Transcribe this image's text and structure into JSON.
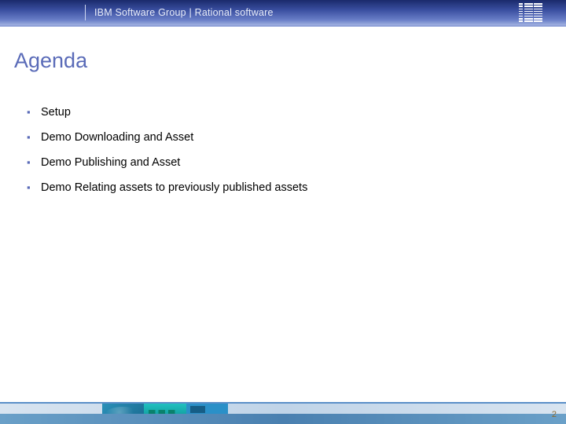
{
  "header": {
    "title": "IBM Software Group | Rational software",
    "logo_name": "ibm-logo"
  },
  "slide": {
    "title": "Agenda",
    "bullets": [
      "Setup",
      "Demo Downloading and Asset",
      "Demo Publishing and Asset",
      "Demo Relating assets to previously published assets"
    ]
  },
  "footer": {
    "page_number": "2"
  }
}
